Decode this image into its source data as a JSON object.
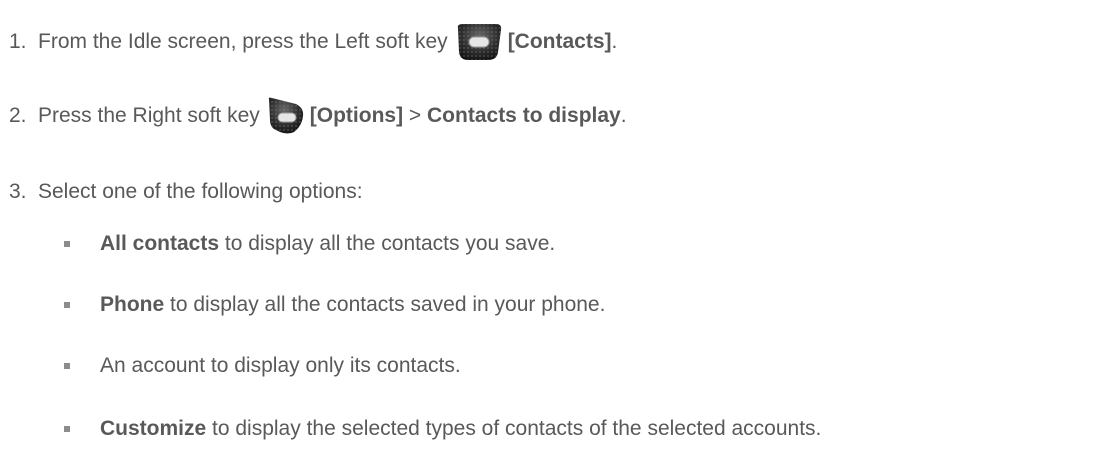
{
  "steps": [
    {
      "number": "1.",
      "text_before": "From the Idle screen, press the Left soft key",
      "key_icon": "left-soft-key-icon",
      "label": "[Contacts]",
      "separator": "",
      "label2": "",
      "end": "."
    },
    {
      "number": "2.",
      "text_before": "Press the Right soft key",
      "key_icon": "right-soft-key-icon",
      "label": "[Options]",
      "separator": " > ",
      "label2": "Contacts to display",
      "end": "."
    },
    {
      "number": "3.",
      "text": "Select one of the following options:"
    }
  ],
  "options": [
    {
      "bold": "All contacts",
      "text": " to display all the contacts you save."
    },
    {
      "bold": "Phone",
      "text": " to display all the contacts saved in your phone."
    },
    {
      "bold": "",
      "text": "An account to display only its contacts."
    },
    {
      "bold": "Customize",
      "text": " to display the selected types of contacts of the selected accounts."
    }
  ],
  "colors": {
    "text": "#595959",
    "bullet": "#8c8c8c",
    "key_body": "#2a2a2a"
  }
}
